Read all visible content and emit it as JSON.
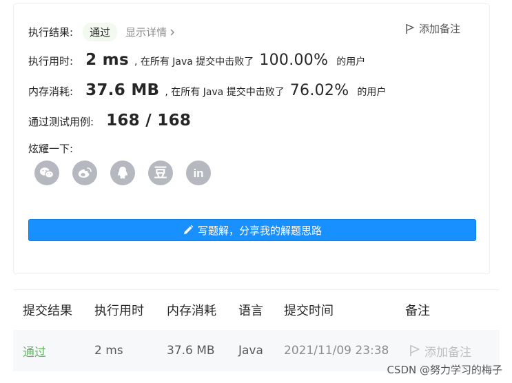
{
  "result": {
    "status_label": "执行结果:",
    "status_value": "通过",
    "details_link": "显示详情",
    "add_note": "添加备注",
    "runtime_label": "执行用时:",
    "runtime_value": "2 ms",
    "runtime_mid": ", 在所有 Java 提交中击败了",
    "runtime_pct": "100.00%",
    "runtime_tail": "的用户",
    "memory_label": "内存消耗:",
    "memory_value": "37.6 MB",
    "memory_mid": ", 在所有 Java 提交中击败了",
    "memory_pct": "76.02%",
    "memory_tail": "的用户",
    "tests_label": "通过测试用例:",
    "tests_value": "168 / 168",
    "share_label": "炫耀一下:",
    "share_icons": [
      "wechat-icon",
      "weibo-icon",
      "qq-icon",
      "douban-icon",
      "linkedin-icon"
    ],
    "douban_glyph": "豆",
    "linkedin_glyph": "in",
    "solution_button": "写题解，分享我的解题思路"
  },
  "table": {
    "headers": [
      "提交结果",
      "执行用时",
      "内存消耗",
      "语言",
      "提交时间",
      "备注"
    ],
    "row": {
      "status": "通过",
      "runtime": "2 ms",
      "memory": "37.6 MB",
      "language": "Java",
      "time": "2021/11/09 23:38",
      "note": "添加备注"
    }
  },
  "watermark": "CSDN @努力学习的梅子",
  "colors": {
    "primary": "#1890ff",
    "pass_green": "#5cb85c",
    "pill_bg": "#f2f9ee",
    "icon_gray": "#b5b9bf"
  }
}
